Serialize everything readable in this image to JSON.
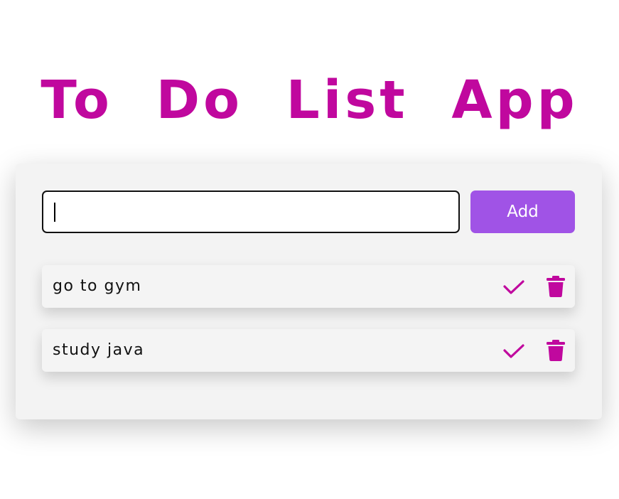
{
  "header": {
    "title": "To Do List App"
  },
  "input": {
    "value": "",
    "placeholder": ""
  },
  "add_button": {
    "label": "Add"
  },
  "tasks": [
    {
      "text": "go to gym",
      "complete_icon": "check-icon",
      "delete_icon": "trash-icon"
    },
    {
      "text": "study java",
      "complete_icon": "check-icon",
      "delete_icon": "trash-icon"
    }
  ],
  "colors": {
    "title": "#c0089e",
    "add_button": "#a053e6",
    "icons": "#c0089e",
    "card_background": "#f3f3f3"
  }
}
